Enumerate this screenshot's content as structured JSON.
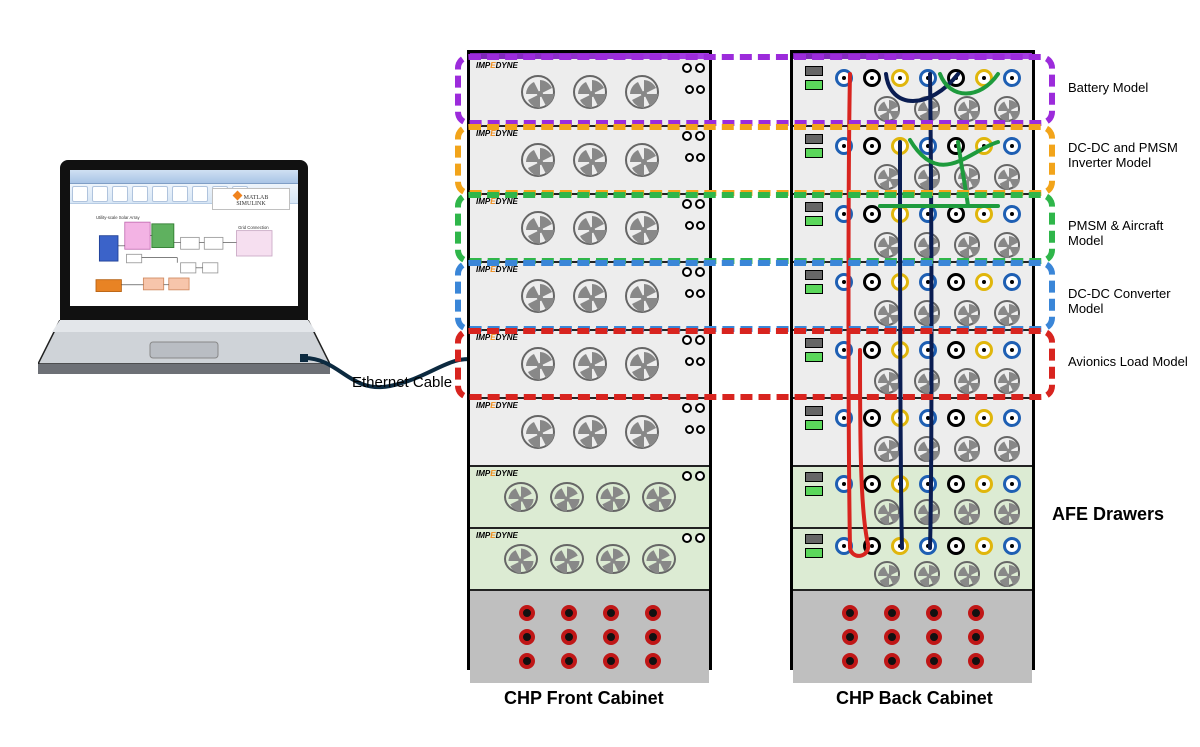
{
  "laptop": {
    "brand_line1": "MATLAB",
    "brand_line2": "SIMULINK",
    "model_caption_tl": "Utility-scale Solar Array",
    "model_caption_tr": "Grid Connection"
  },
  "ethernet_label": "Ethernet Cable",
  "drawer_brand": "IMPEDYNE",
  "rings": [
    {
      "label": "Battery Model"
    },
    {
      "label": "DC-DC and PMSM Inverter Model"
    },
    {
      "label": "PMSM & Aircraft Model"
    },
    {
      "label": "DC-DC Converter Model"
    },
    {
      "label": "Avionics Load Model"
    }
  ],
  "afe_label": "AFE Drawers",
  "front_caption": "CHP Front Cabinet",
  "back_caption": "CHP Back Cabinet"
}
